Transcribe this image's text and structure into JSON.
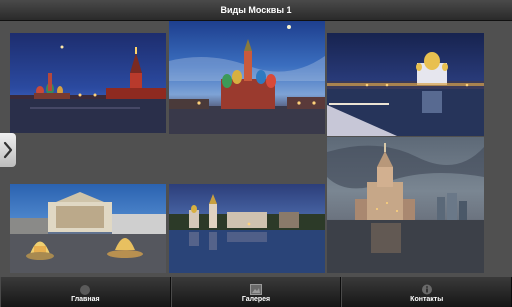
{
  "window": {
    "title": "Виды Москвы 1"
  },
  "gallery": {
    "tiles": [
      {
        "name": "kremlin-night-photo"
      },
      {
        "name": "st-basils-cathedral-photo"
      },
      {
        "name": "christ-the-saviour-cathedral-photo"
      },
      {
        "name": "bolshoi-theatre-photo"
      },
      {
        "name": "novodevichy-convent-photo"
      },
      {
        "name": "hotel-ukraina-photo"
      }
    ]
  },
  "nav": {
    "icon": "chevron-right-icon"
  },
  "tabbar": {
    "tabs": [
      {
        "label": "Главная",
        "icon": "home-icon"
      },
      {
        "label": "Галерея",
        "icon": "gallery-icon"
      },
      {
        "label": "Контакты",
        "icon": "info-icon"
      }
    ]
  },
  "colors": {
    "titlebar": "#2f2f2f",
    "content_bg": "#505050",
    "tabbar": "#222222",
    "text": "#ffffff"
  }
}
